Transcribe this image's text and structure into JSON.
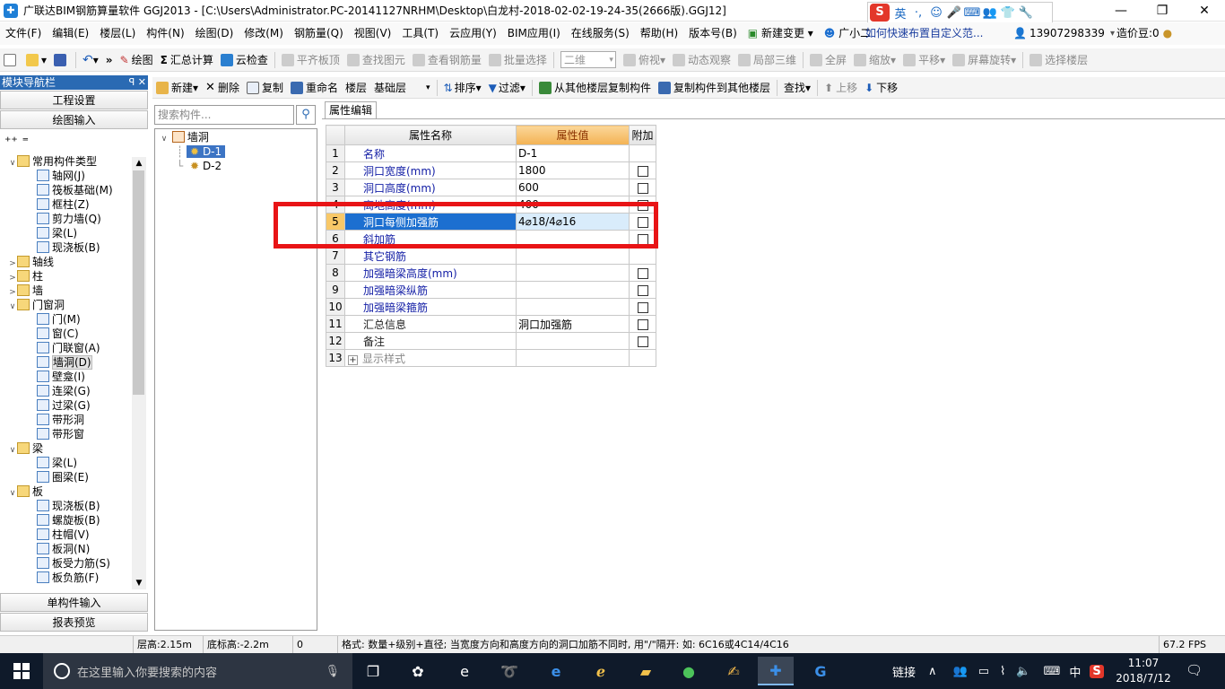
{
  "window": {
    "title": "广联达BIM钢筋算量软件 GGJ2013 - [C:\\Users\\Administrator.PC-20141127NRHM\\Desktop\\白龙村-2018-02-02-19-24-35(2666版).GGJ12]",
    "min": "—",
    "restore": "❐",
    "close": "✕"
  },
  "ime": {
    "logo": "S",
    "items": [
      "英",
      "·,",
      "☺",
      "🎤",
      "⌨",
      "👥",
      "👕",
      "🔧"
    ]
  },
  "menu": {
    "items": [
      "文件(F)",
      "编辑(E)",
      "楼层(L)",
      "构件(N)",
      "绘图(D)",
      "修改(M)",
      "钢筋量(Q)",
      "视图(V)",
      "工具(T)",
      "云应用(Y)",
      "BIM应用(I)",
      "在线服务(S)",
      "帮助(H)",
      "版本号(B)",
      "新建变更",
      "广小二"
    ],
    "help_link": "如何快速布置自定义范...",
    "phone": "13907298339",
    "price_bean": "造价豆:0"
  },
  "toolbar1": {
    "draw": "绘图",
    "sum": "汇总计算",
    "cloud_check": "云检查",
    "flat_top": "平齐板顶",
    "find_elem": "查找图元",
    "view_rebar": "查看钢筋量",
    "batch_select": "批量选择",
    "view_mode": "二维",
    "top_view": "俯视",
    "dynamic_view": "动态观察",
    "local_3d": "局部三维",
    "full_screen": "全屏",
    "zoom": "缩放",
    "pan": "平移",
    "rotate": "屏幕旋转",
    "select_floor": "选择楼层"
  },
  "toolbar2": {
    "new": "新建",
    "delete": "删除",
    "copy": "复制",
    "rename": "重命名",
    "floor_label": "楼层",
    "floor_value": "基础层",
    "sort": "排序",
    "filter": "过滤",
    "copy_from": "从其他楼层复制构件",
    "copy_to": "复制构件到其他楼层",
    "find": "查找",
    "up": "上移",
    "down": "下移"
  },
  "nav": {
    "header": "模块导航栏",
    "pins": "ꟼ ✕",
    "project_settings": "工程设置",
    "drawing_input": "绘图输入",
    "single_input": "单构件输入",
    "report_preview": "报表预览",
    "tree": [
      {
        "level": 0,
        "twisty": "∨",
        "folder": true,
        "label": "常用构件类型"
      },
      {
        "level": 1,
        "label": "轴网(J)"
      },
      {
        "level": 1,
        "label": "筏板基础(M)"
      },
      {
        "level": 1,
        "label": "框柱(Z)"
      },
      {
        "level": 1,
        "label": "剪力墙(Q)"
      },
      {
        "level": 1,
        "label": "梁(L)"
      },
      {
        "level": 1,
        "label": "现浇板(B)"
      },
      {
        "level": 0,
        "twisty": ">",
        "folder": true,
        "label": "轴线"
      },
      {
        "level": 0,
        "twisty": ">",
        "folder": true,
        "label": "柱"
      },
      {
        "level": 0,
        "twisty": ">",
        "folder": true,
        "label": "墙"
      },
      {
        "level": 0,
        "twisty": "∨",
        "folder": true,
        "label": "门窗洞"
      },
      {
        "level": 1,
        "label": "门(M)"
      },
      {
        "level": 1,
        "label": "窗(C)"
      },
      {
        "level": 1,
        "label": "门联窗(A)"
      },
      {
        "level": 1,
        "label": "墙洞(D)",
        "selected": true
      },
      {
        "level": 1,
        "label": "壁龛(I)"
      },
      {
        "level": 1,
        "label": "连梁(G)"
      },
      {
        "level": 1,
        "label": "过梁(G)"
      },
      {
        "level": 1,
        "label": "带形洞"
      },
      {
        "level": 1,
        "label": "带形窗"
      },
      {
        "level": 0,
        "twisty": "∨",
        "folder": true,
        "label": "梁"
      },
      {
        "level": 1,
        "label": "梁(L)"
      },
      {
        "level": 1,
        "label": "圈梁(E)"
      },
      {
        "level": 0,
        "twisty": "∨",
        "folder": true,
        "label": "板"
      },
      {
        "level": 1,
        "label": "现浇板(B)"
      },
      {
        "level": 1,
        "label": "螺旋板(B)"
      },
      {
        "level": 1,
        "label": "柱帽(V)"
      },
      {
        "level": 1,
        "label": "板洞(N)"
      },
      {
        "level": 1,
        "label": "板受力筋(S)"
      },
      {
        "level": 1,
        "label": "板负筋(F)"
      }
    ]
  },
  "component_tree": {
    "search_placeholder": "搜索构件...",
    "root": "墙洞",
    "items": [
      "D-1",
      "D-2"
    ]
  },
  "property": {
    "tab": "属性编辑",
    "headers": [
      "属性名称",
      "属性值",
      "附加"
    ],
    "rows": [
      {
        "n": "1",
        "name": "名称",
        "value": "D-1",
        "check": false,
        "color": "blue"
      },
      {
        "n": "2",
        "name": "洞口宽度(mm)",
        "value": "1800",
        "check": true,
        "color": "blue"
      },
      {
        "n": "3",
        "name": "洞口高度(mm)",
        "value": "600",
        "check": true,
        "color": "blue"
      },
      {
        "n": "4",
        "name": "离地高度(mm)",
        "value": "400",
        "check": true,
        "color": "blue"
      },
      {
        "n": "5",
        "name": "洞口每侧加强筋",
        "value": "4⌀18/4⌀16",
        "check": true,
        "color": "blue",
        "selected": true
      },
      {
        "n": "6",
        "name": "斜加筋",
        "value": "",
        "check": true,
        "color": "blue"
      },
      {
        "n": "7",
        "name": "其它钢筋",
        "value": "",
        "check": false,
        "color": "blue"
      },
      {
        "n": "8",
        "name": "加强暗梁高度(mm)",
        "value": "",
        "check": true,
        "color": "blue"
      },
      {
        "n": "9",
        "name": "加强暗梁纵筋",
        "value": "",
        "check": true,
        "color": "blue"
      },
      {
        "n": "10",
        "name": "加强暗梁箍筋",
        "value": "",
        "check": true,
        "color": "blue"
      },
      {
        "n": "11",
        "name": "汇总信息",
        "value": "洞口加强筋",
        "check": true,
        "color": "black"
      },
      {
        "n": "12",
        "name": "备注",
        "value": "",
        "check": true,
        "color": "black"
      },
      {
        "n": "13",
        "name": "显示样式",
        "value": "",
        "check": false,
        "color": "gray",
        "expand": "+"
      }
    ]
  },
  "status": {
    "floor_height": "层高:2.15m",
    "base_height": "底标高:-2.2m",
    "count": "0",
    "hint": "格式: 数量+级别+直径; 当宽度方向和高度方向的洞口加筋不同时, 用\"/\"隔开: 如: 6C16或4C14/4C16",
    "fps": "67.2 FPS"
  },
  "taskbar": {
    "search_placeholder": "在这里输入你要搜索的内容",
    "tray_link": "链接",
    "ime": "中",
    "time": "11:07",
    "date": "2018/7/12"
  },
  "colors": {
    "accent": "#2a6ab3",
    "highlight_box": "#e81416",
    "selected_row": "#1c6fd0"
  }
}
